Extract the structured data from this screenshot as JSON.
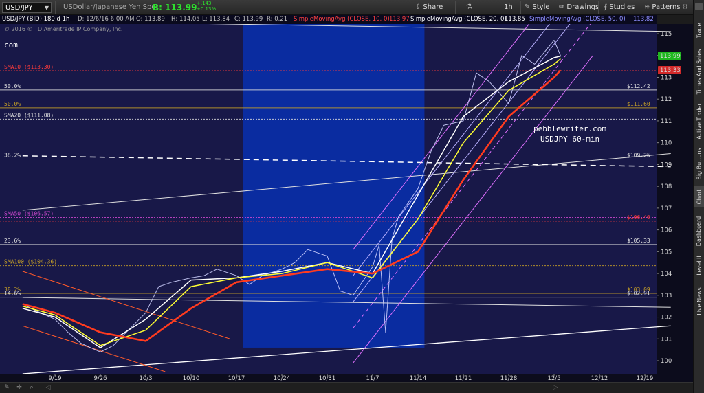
{
  "toolbar": {
    "symbol": "USD/JPY",
    "description": "USDollar/Japanese Yen Spot",
    "last_label": "B:",
    "last_price": "113.99",
    "change": "+.143",
    "change_pct": "+0.13%",
    "buttons": [
      {
        "label": "Share",
        "icon": "share-icon"
      },
      {
        "label": "1h",
        "icon": ""
      },
      {
        "label": "Style",
        "icon": "style-icon"
      },
      {
        "label": "Drawings",
        "icon": "drawings-icon"
      },
      {
        "label": "Studies",
        "icon": "studies-icon"
      },
      {
        "label": "Patterns",
        "icon": "patterns-icon"
      }
    ]
  },
  "legend": {
    "items": [
      {
        "text": "USD/JPY (BID) 180 d 1h",
        "color": "#ffffff"
      },
      {
        "text": "D: 12/6/16 6:00 AM",
        "color": "#bfbfbf"
      },
      {
        "text": "O: 113.89",
        "color": "#bfbfbf"
      },
      {
        "text": "H: 114.05",
        "color": "#bfbfbf"
      },
      {
        "text": "L: 113.84",
        "color": "#bfbfbf"
      },
      {
        "text": "C: 113.99",
        "color": "#bfbfbf"
      },
      {
        "text": "R: 0.21",
        "color": "#bfbfbf"
      },
      {
        "text": "SimpleMovingAvg (CLOSE, 10, 0)",
        "color": "#ff4040"
      },
      {
        "text": "113.97",
        "color": "#ff4040"
      },
      {
        "text": "SimpleMovingAvg (CLOSE, 20, 0)",
        "color": "#ffffff"
      },
      {
        "text": "113.85",
        "color": "#ffffff"
      },
      {
        "text": "SimpleMovingAvg (CLOSE, 50, 0)",
        "color": "#8f8fff"
      },
      {
        "text": "113.82",
        "color": "#8f8fff"
      }
    ],
    "copyright": "© 2016 © TD Ameritrade IP Company, Inc."
  },
  "side_tabs": [
    "Trade",
    "Times And Sales",
    "Active Trader",
    "Big Buttons",
    "Chart",
    "Dashboard",
    "Level II",
    "Live News"
  ],
  "active_tab": "Chart",
  "chart_data": {
    "type": "line",
    "instrument": "USD/JPY (BID)",
    "interval": "1h",
    "x_tick_labels": [
      "9/19",
      "9/26",
      "10/3",
      "10/10",
      "10/17",
      "10/24",
      "10/31",
      "11/7",
      "11/14",
      "11/21",
      "11/28",
      "12/5",
      "12/12",
      "12/19"
    ],
    "y_tick_labels": [
      "100",
      "101",
      "102",
      "103",
      "104",
      "105",
      "106",
      "107",
      "108",
      "109",
      "110",
      "111",
      "112",
      "113",
      "114",
      "115"
    ],
    "ylim": [
      99.5,
      115.5
    ],
    "series": [
      {
        "name": "USD/JPY",
        "color": "#cfd2ff",
        "x": [
          "9/14",
          "9/16",
          "9/19",
          "9/21",
          "9/23",
          "9/26",
          "9/28",
          "9/30",
          "10/3",
          "10/5",
          "10/7",
          "10/10",
          "10/12",
          "10/14",
          "10/17",
          "10/19",
          "10/21",
          "10/24",
          "10/26",
          "10/28",
          "10/31",
          "11/2",
          "11/4",
          "11/7",
          "11/8",
          "11/9",
          "11/10",
          "11/11",
          "11/14",
          "11/16",
          "11/18",
          "11/21",
          "11/23",
          "11/25",
          "11/28",
          "11/30",
          "12/2",
          "12/5",
          "12/6"
        ],
        "y": [
          102.6,
          102.3,
          101.9,
          101.3,
          100.8,
          100.4,
          100.7,
          101.3,
          102.2,
          103.4,
          103.6,
          103.8,
          103.9,
          104.2,
          103.9,
          103.5,
          103.9,
          104.2,
          104.5,
          105.1,
          104.8,
          103.2,
          103.0,
          104.3,
          105.3,
          101.3,
          105.6,
          106.6,
          107.9,
          109.6,
          110.8,
          111.0,
          113.2,
          112.8,
          111.8,
          114.0,
          113.6,
          114.7,
          113.99
        ]
      },
      {
        "name": "SimpleMovingAvg (CLOSE, 10, 0)",
        "color": "#ffffff",
        "x": [
          "9/14",
          "9/19",
          "9/26",
          "10/3",
          "10/10",
          "10/17",
          "10/24",
          "10/31",
          "11/7",
          "11/14",
          "11/21",
          "11/28",
          "12/5",
          "12/6"
        ],
        "y": [
          102.4,
          102.0,
          100.6,
          101.9,
          103.7,
          103.8,
          104.1,
          104.5,
          104.0,
          107.6,
          111.2,
          112.8,
          113.9,
          113.97
        ]
      },
      {
        "name": "SimpleMovingAvg (CLOSE, 20, 0)",
        "color": "#ffff33",
        "x": [
          "9/14",
          "9/19",
          "9/26",
          "10/3",
          "10/10",
          "10/17",
          "10/24",
          "10/31",
          "11/7",
          "11/14",
          "11/21",
          "11/28",
          "12/5",
          "12/6"
        ],
        "y": [
          102.5,
          102.1,
          100.7,
          101.4,
          103.4,
          103.8,
          104.0,
          104.5,
          103.8,
          106.5,
          110.0,
          112.4,
          113.6,
          113.85
        ]
      },
      {
        "name": "SimpleMovingAvg (CLOSE, 50, 0)",
        "color": "#ff3b1f",
        "x": [
          "9/14",
          "9/19",
          "9/26",
          "10/3",
          "10/10",
          "10/17",
          "10/24",
          "10/31",
          "11/7",
          "11/14",
          "11/21",
          "11/28",
          "12/5",
          "12/6"
        ],
        "y": [
          102.6,
          102.2,
          101.3,
          100.9,
          102.4,
          103.6,
          103.9,
          104.2,
          104.0,
          105.0,
          108.3,
          111.2,
          113.0,
          113.33
        ]
      }
    ],
    "price_tags": [
      {
        "value": "113.99",
        "color": "#1fb81f"
      },
      {
        "value": "113.33",
        "color": "#d22a2a"
      }
    ],
    "annotations": [
      {
        "text": "com",
        "color": "#ffffff"
      },
      {
        "text": "pebblewriter.com",
        "color": "#ffffff"
      },
      {
        "text": "USDJPY 60-min",
        "color": "#ffffff"
      }
    ],
    "horizontal_levels": [
      {
        "left_label": "SMA10 ($113.30)",
        "right_label": "",
        "value": 113.3,
        "color": "#ff3b3b",
        "style": "dotted"
      },
      {
        "left_label": "50.0%",
        "right_label": "$112.42",
        "value": 112.42,
        "color": "#e0e0e0",
        "style": "solid"
      },
      {
        "left_label": "50.0%",
        "right_label": "$111.60",
        "value": 111.6,
        "color": "#c9a227",
        "style": "solid"
      },
      {
        "left_label": "SMA20 ($111.08)",
        "right_label": "",
        "value": 111.08,
        "color": "#e0e0e0",
        "style": "dotted"
      },
      {
        "left_label": "38.2%",
        "right_label": "$109.25",
        "value": 109.25,
        "color": "#e0e0e0",
        "style": "solid"
      },
      {
        "left_label": "SMA50 ($106.57)",
        "right_label": "",
        "value": 106.57,
        "color": "#d048d0",
        "style": "dotted"
      },
      {
        "left_label": "",
        "right_label": "$106.40",
        "value": 106.4,
        "color": "#ff3b3b",
        "style": "dotted"
      },
      {
        "left_label": "23.6%",
        "right_label": "$105.33",
        "value": 105.33,
        "color": "#e0e0e0",
        "style": "solid"
      },
      {
        "left_label": "SMA100 ($104.36)",
        "right_label": "",
        "value": 104.36,
        "color": "#c9a227",
        "style": "dotted"
      },
      {
        "left_label": "38.2%",
        "right_label": "$103.09",
        "value": 103.09,
        "color": "#c9a227",
        "style": "solid"
      },
      {
        "left_label": "14.6%",
        "right_label": "$102.91",
        "value": 102.91,
        "color": "#e0e0e0",
        "style": "solid"
      }
    ],
    "highlight_region": {
      "x_from": "10/18",
      "x_to": "11/15",
      "y_from": 100.6,
      "y_to": 115.5,
      "color": "#0a2fa8"
    },
    "grid": false,
    "legend_position": "top"
  }
}
